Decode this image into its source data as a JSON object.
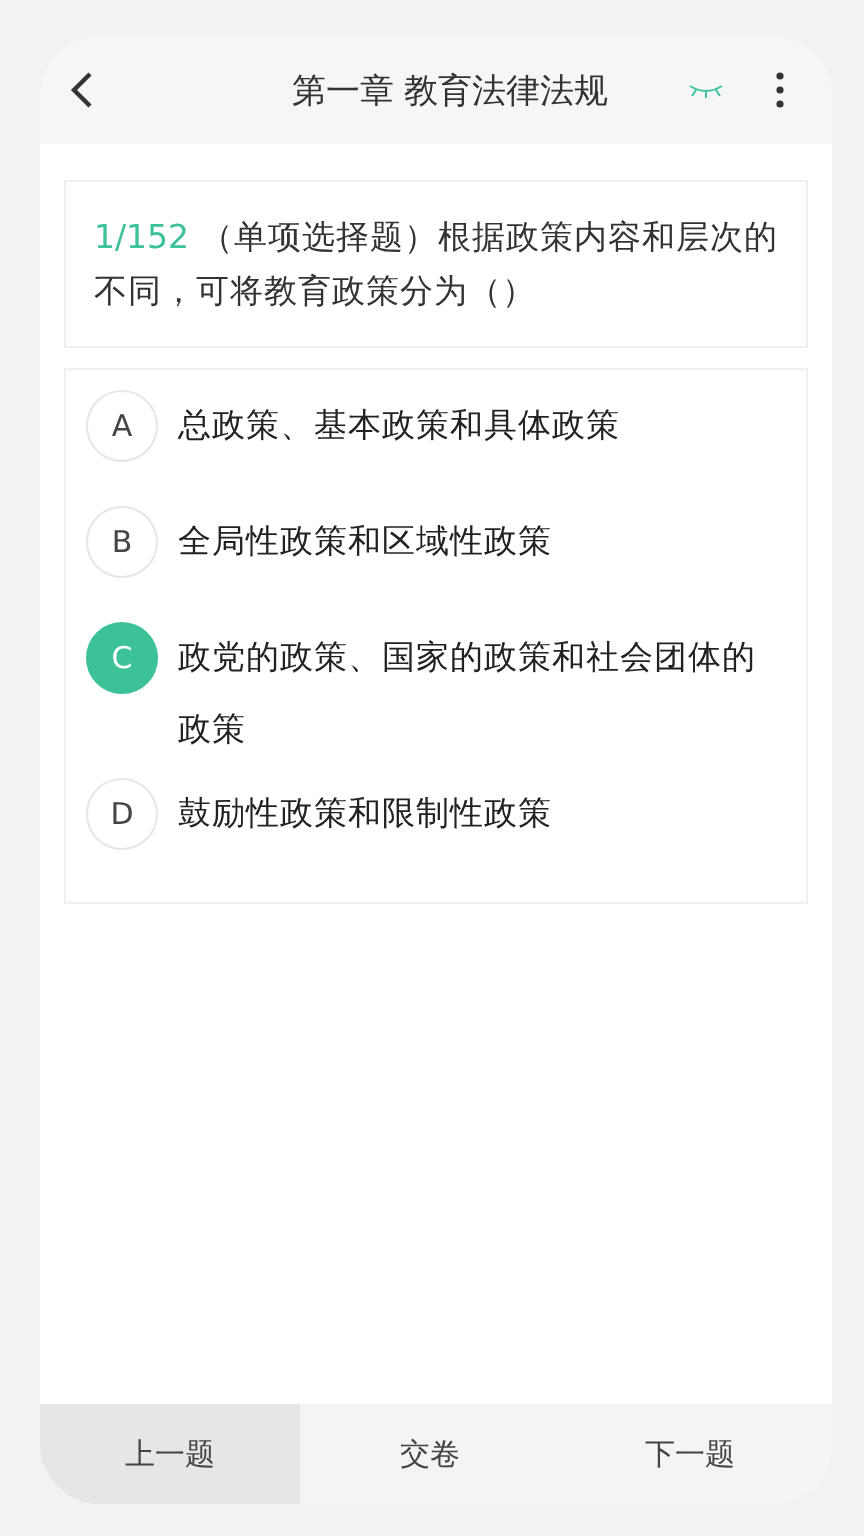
{
  "header": {
    "title": "第一章 教育法律法规"
  },
  "question": {
    "number": "1/152",
    "text": "（单项选择题）根据政策内容和层次的不同，可将教育政策分为（）"
  },
  "options": [
    {
      "letter": "A",
      "text": "总政策、基本政策和具体政策",
      "selected": false
    },
    {
      "letter": "B",
      "text": "全局性政策和区域性政策",
      "selected": false
    },
    {
      "letter": "C",
      "text": "政党的政策、国家的政策和社会团体的政策",
      "selected": true
    },
    {
      "letter": "D",
      "text": "鼓励性政策和限制性政策",
      "selected": false
    }
  ],
  "bottom_bar": [
    {
      "label": "上一题",
      "selected": true
    },
    {
      "label": "交卷",
      "selected": false
    },
    {
      "label": "下一题",
      "selected": false
    }
  ]
}
